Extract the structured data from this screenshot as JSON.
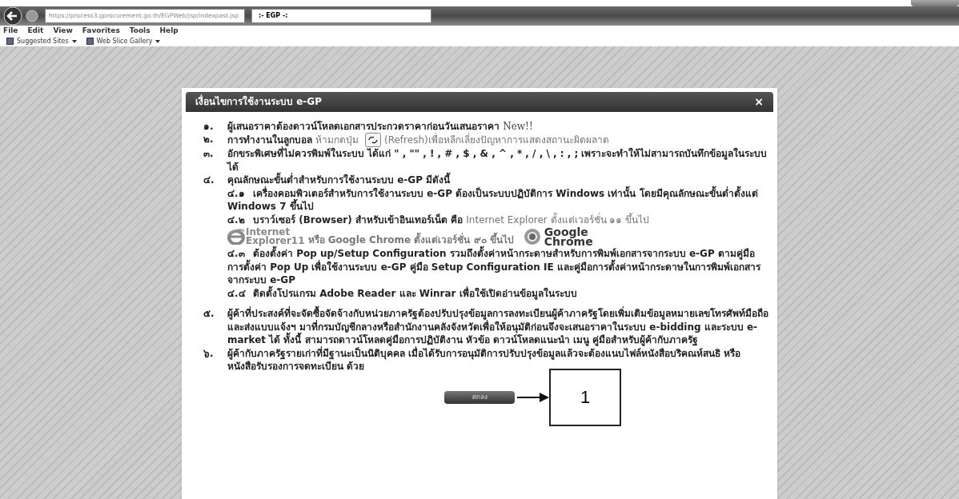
{
  "browser": {
    "address": "https://process3.gprocurement.go.th/EGPWeb/jsp/indexpast.jsp",
    "tabs": [
      {
        "label": ":- EGP -:",
        "selected": true
      }
    ],
    "menu": [
      "File",
      "Edit",
      "View",
      "Favorites",
      "Tools",
      "Help"
    ],
    "favorites": [
      "Suggested Sites",
      "Web Slice Gallery"
    ]
  },
  "dialog": {
    "title": "เงื่อนไขการใช้งานระบบ e-GP",
    "close": "×",
    "items": [
      {
        "number": "๑.",
        "segments": [
          {
            "text": "ผู้เสนอราคาต้องดาวน์โหลดเอกสารประกวดราคาก่อนวันเสนอราคา ",
            "kind": "normal"
          },
          {
            "text": "New!!",
            "kind": "serif"
          }
        ]
      },
      {
        "number": "๒.",
        "segments": [
          {
            "text": "การทำงานในลูกบอล",
            "kind": "bold"
          },
          {
            "text": "ห้ามกดปุ่ม",
            "kind": "muted"
          },
          {
            "kind": "icon"
          },
          {
            "text": "(Refresh)เพื่อหลีกเลี่ยงปัญหาการแสดงสถานะผิดผลาด",
            "kind": "muted"
          }
        ]
      },
      {
        "number": "๓.",
        "segments": [
          {
            "text": "อักขระพิเศษที่ไม่ควรพิมพ์ในระบบ ได้แก่ \" , \"\" , ! , # , $ , & , ^ , * , / , \\ , : , ; เพราะจะทำให้ไม่สามารถบันทึกข้อมูลในระบบได้",
            "kind": "bold"
          }
        ]
      },
      {
        "number": "๔.",
        "segments": [
          {
            "text": "คุณลักษณะขั้นต่ำสำหรับการใช้งานระบบ e-GP มีดังนี้",
            "kind": "normal"
          }
        ],
        "children": [
          {
            "number": "๔.๑",
            "segments": [
              {
                "text": "เครื่องคอมพิวเตอร์สำหรับการใช้งานระบบ e-GP ต้องเป็นระบบปฏิบัติการ Windows เท่านั้น โดยมีคุณลักษณะขั้นต่ำตั้งแต่ Windows 7 ขึ้นไป",
                "kind": "normal"
              }
            ]
          },
          {
            "number": "๔.๒",
            "segments": [
              {
                "text": "บราว์เซอร์ (Browser) สำหรับเข้าอินเทอร์เน็ต คือ ",
                "kind": "normal"
              },
              {
                "text": "Internet Explorer ตั้งแต่เวอร์ชั่น ๑๑ ขึ้นไป",
                "kind": "muted"
              }
            ],
            "logos": {
              "ie": [
                "Internet",
                "Explorer11"
              ],
              "text": "หรือ Google Chrome ตั้งแต่เวอร์ชั่น ๙๐ ขึ้นไป",
              "chrome": [
                "Google",
                "Chrome"
              ]
            }
          },
          {
            "number": "๔.๓",
            "segments": [
              {
                "text": "ต้องตั้งค่า Pop up/Setup Configuration รวมถึงตั้งค่าหน้ากระดาษสำหรับการพิมพ์เอกสารจากระบบ e-GP ตามคู่มือการตั้งค่า Pop Up เพื่อใช้งานระบบ e-GP คู่มือ Setup Configuration IE และคู่มือการตั้งค่าหน้ากระดาษในการพิมพ์เอกสารจากระบบ e-GP",
                "kind": "normal"
              }
            ]
          },
          {
            "number": "๔.๔",
            "segments": [
              {
                "text": "ติดตั้งโปรแกรม Adobe Reader และ Winrar เพื่อใช้เปิดอ่านข้อมูลในระบบ",
                "kind": "normal"
              }
            ]
          }
        ]
      },
      {
        "number": "๕.",
        "segments": [
          {
            "text": "ผู้ค้าที่ประสงค์ที่จะจัดซื้อจัดจ้างกับหน่วยภาครัฐต้องปรับปรุงข้อมูลการลงทะเบียนผู้ค้าภาครัฐโดยเพิ่มเติมข้อมูลหมายเลขโทรศัพท์มือถือ และส่งแบบแจ้งฯ มาที่กรมบัญชีกลางหรือสำนักงานคลังจังหวัดเพื่อให้อนุมัติก่อนจึงจะเสนอราคาในระบบ e-bidding และระบบ e-market ได้ ทั้งนี้ สามารถดาวน์โหลดคู่มือการปฏิบัติงาน หัวข้อ ดาวน์โหลดแนะนำ เมนู คู่มือสำหรับผู้ค้ากับภาครัฐ",
            "kind": "normal"
          }
        ]
      },
      {
        "number": "๖.",
        "segments": [
          {
            "text": "ผู้ค้ากับภาครัฐรายเก่าที่มีฐานะเป็นนิติบุคคล เมื่อได้รับการอนุมัติการปรับปรุงข้อมูลแล้วจะต้องแนบไฟล์หนังสือบริคณห์สนธิ หรือหนังสือรับรองการจดทะเบียน ด้วย",
            "kind": "normal"
          }
        ]
      }
    ],
    "button": "ตกลง"
  },
  "annotation": {
    "label": "1"
  }
}
